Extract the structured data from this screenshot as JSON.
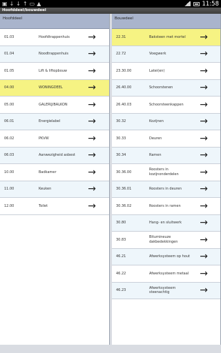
{
  "statusbar": {
    "time": "11:58",
    "left_icons": [
      "image-icon",
      "download-icon",
      "download-icon",
      "upload-icon",
      "keyboard-icon",
      "notification-icon"
    ],
    "right_icons": [
      "signal-icon",
      "battery-icon"
    ]
  },
  "titlebar": {
    "title": "Hoofddeel/bouwdeel"
  },
  "left_pane": {
    "header": "Hoofddeel",
    "rows": [
      {
        "code": "01.03",
        "label": "Hoofdtrappenhuis",
        "highlight": false
      },
      {
        "code": "01.04",
        "label": "Noodtrappenhuis",
        "highlight": false
      },
      {
        "code": "01.05",
        "label": "Lift & liftopbouw",
        "highlight": false
      },
      {
        "code": "04.00",
        "label": "WONINGDEEL",
        "highlight": true
      },
      {
        "code": "05.00",
        "label": "GALERIJ/BALKON",
        "highlight": false
      },
      {
        "code": "06.01",
        "label": "Energielabel",
        "highlight": false
      },
      {
        "code": "06.02",
        "label": "PKVW",
        "highlight": false
      },
      {
        "code": "06.03",
        "label": "Aanwezigheid asbest",
        "highlight": false
      },
      {
        "code": "10.00",
        "label": "Badkamer",
        "highlight": false
      },
      {
        "code": "11.00",
        "label": "Keuken",
        "highlight": false
      },
      {
        "code": "12.00",
        "label": "Toilet",
        "highlight": false
      }
    ]
  },
  "right_pane": {
    "header": "Bouwdeel",
    "rows": [
      {
        "code": "22.31",
        "label": "Baksteen met mortel",
        "highlight": true
      },
      {
        "code": "22.72",
        "label": "Voegwerk",
        "highlight": false
      },
      {
        "code": "23.30.00",
        "label": "Latei(en)",
        "highlight": false
      },
      {
        "code": "26.40.00",
        "label": "Schoorstenen",
        "highlight": false
      },
      {
        "code": "26.40.03",
        "label": "Schoorsteenkappen",
        "highlight": false
      },
      {
        "code": "30.32",
        "label": "Kozijnen",
        "highlight": false
      },
      {
        "code": "30.33",
        "label": "Deuren",
        "highlight": false
      },
      {
        "code": "30.34",
        "label": "Ramen",
        "highlight": false
      },
      {
        "code": "30.36.00",
        "label": "Roosters in kozijnonderdelen",
        "highlight": false
      },
      {
        "code": "30.36.01",
        "label": "Roosters in deuren",
        "highlight": false
      },
      {
        "code": "30.36.02",
        "label": "Roosters in ramen",
        "highlight": false
      },
      {
        "code": "30.80",
        "label": "Hang- en sluitwerk",
        "highlight": false
      },
      {
        "code": "30.83",
        "label": "Bitumineuze dakbedekkingen",
        "highlight": false
      },
      {
        "code": "46.21",
        "label": "Afwerksysteem op hout",
        "highlight": false
      },
      {
        "code": "46.22",
        "label": "Afwerksysteem metaal",
        "highlight": false
      },
      {
        "code": "46.23",
        "label": "Afwerksysteem steenachtig",
        "highlight": false
      }
    ]
  },
  "arrow_glyph": "→",
  "colors": {
    "header_bg": "#a9b4cc",
    "highlight": "#f6f383",
    "alt_row": "#eef6fb",
    "statusbar": "#000000"
  }
}
